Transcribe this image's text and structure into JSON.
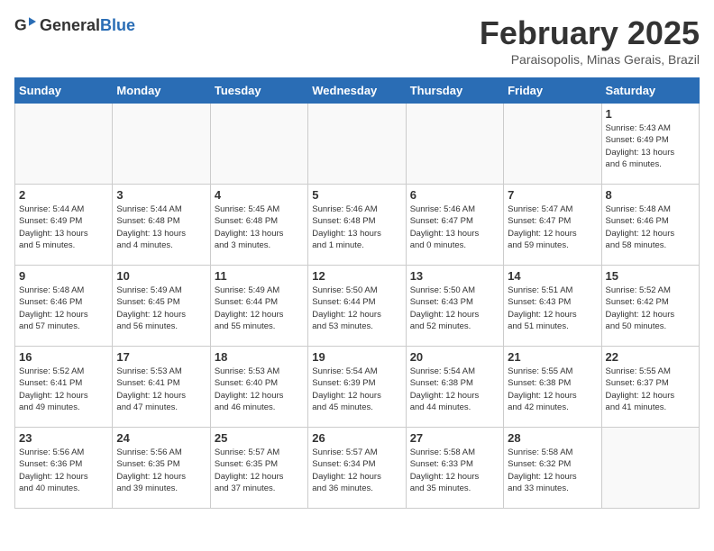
{
  "header": {
    "logo_general": "General",
    "logo_blue": "Blue",
    "title": "February 2025",
    "subtitle": "Paraisopolis, Minas Gerais, Brazil"
  },
  "days_of_week": [
    "Sunday",
    "Monday",
    "Tuesday",
    "Wednesday",
    "Thursday",
    "Friday",
    "Saturday"
  ],
  "weeks": [
    [
      {
        "day": "",
        "info": ""
      },
      {
        "day": "",
        "info": ""
      },
      {
        "day": "",
        "info": ""
      },
      {
        "day": "",
        "info": ""
      },
      {
        "day": "",
        "info": ""
      },
      {
        "day": "",
        "info": ""
      },
      {
        "day": "1",
        "info": "Sunrise: 5:43 AM\nSunset: 6:49 PM\nDaylight: 13 hours\nand 6 minutes."
      }
    ],
    [
      {
        "day": "2",
        "info": "Sunrise: 5:44 AM\nSunset: 6:49 PM\nDaylight: 13 hours\nand 5 minutes."
      },
      {
        "day": "3",
        "info": "Sunrise: 5:44 AM\nSunset: 6:48 PM\nDaylight: 13 hours\nand 4 minutes."
      },
      {
        "day": "4",
        "info": "Sunrise: 5:45 AM\nSunset: 6:48 PM\nDaylight: 13 hours\nand 3 minutes."
      },
      {
        "day": "5",
        "info": "Sunrise: 5:46 AM\nSunset: 6:48 PM\nDaylight: 13 hours\nand 1 minute."
      },
      {
        "day": "6",
        "info": "Sunrise: 5:46 AM\nSunset: 6:47 PM\nDaylight: 13 hours\nand 0 minutes."
      },
      {
        "day": "7",
        "info": "Sunrise: 5:47 AM\nSunset: 6:47 PM\nDaylight: 12 hours\nand 59 minutes."
      },
      {
        "day": "8",
        "info": "Sunrise: 5:48 AM\nSunset: 6:46 PM\nDaylight: 12 hours\nand 58 minutes."
      }
    ],
    [
      {
        "day": "9",
        "info": "Sunrise: 5:48 AM\nSunset: 6:46 PM\nDaylight: 12 hours\nand 57 minutes."
      },
      {
        "day": "10",
        "info": "Sunrise: 5:49 AM\nSunset: 6:45 PM\nDaylight: 12 hours\nand 56 minutes."
      },
      {
        "day": "11",
        "info": "Sunrise: 5:49 AM\nSunset: 6:44 PM\nDaylight: 12 hours\nand 55 minutes."
      },
      {
        "day": "12",
        "info": "Sunrise: 5:50 AM\nSunset: 6:44 PM\nDaylight: 12 hours\nand 53 minutes."
      },
      {
        "day": "13",
        "info": "Sunrise: 5:50 AM\nSunset: 6:43 PM\nDaylight: 12 hours\nand 52 minutes."
      },
      {
        "day": "14",
        "info": "Sunrise: 5:51 AM\nSunset: 6:43 PM\nDaylight: 12 hours\nand 51 minutes."
      },
      {
        "day": "15",
        "info": "Sunrise: 5:52 AM\nSunset: 6:42 PM\nDaylight: 12 hours\nand 50 minutes."
      }
    ],
    [
      {
        "day": "16",
        "info": "Sunrise: 5:52 AM\nSunset: 6:41 PM\nDaylight: 12 hours\nand 49 minutes."
      },
      {
        "day": "17",
        "info": "Sunrise: 5:53 AM\nSunset: 6:41 PM\nDaylight: 12 hours\nand 47 minutes."
      },
      {
        "day": "18",
        "info": "Sunrise: 5:53 AM\nSunset: 6:40 PM\nDaylight: 12 hours\nand 46 minutes."
      },
      {
        "day": "19",
        "info": "Sunrise: 5:54 AM\nSunset: 6:39 PM\nDaylight: 12 hours\nand 45 minutes."
      },
      {
        "day": "20",
        "info": "Sunrise: 5:54 AM\nSunset: 6:38 PM\nDaylight: 12 hours\nand 44 minutes."
      },
      {
        "day": "21",
        "info": "Sunrise: 5:55 AM\nSunset: 6:38 PM\nDaylight: 12 hours\nand 42 minutes."
      },
      {
        "day": "22",
        "info": "Sunrise: 5:55 AM\nSunset: 6:37 PM\nDaylight: 12 hours\nand 41 minutes."
      }
    ],
    [
      {
        "day": "23",
        "info": "Sunrise: 5:56 AM\nSunset: 6:36 PM\nDaylight: 12 hours\nand 40 minutes."
      },
      {
        "day": "24",
        "info": "Sunrise: 5:56 AM\nSunset: 6:35 PM\nDaylight: 12 hours\nand 39 minutes."
      },
      {
        "day": "25",
        "info": "Sunrise: 5:57 AM\nSunset: 6:35 PM\nDaylight: 12 hours\nand 37 minutes."
      },
      {
        "day": "26",
        "info": "Sunrise: 5:57 AM\nSunset: 6:34 PM\nDaylight: 12 hours\nand 36 minutes."
      },
      {
        "day": "27",
        "info": "Sunrise: 5:58 AM\nSunset: 6:33 PM\nDaylight: 12 hours\nand 35 minutes."
      },
      {
        "day": "28",
        "info": "Sunrise: 5:58 AM\nSunset: 6:32 PM\nDaylight: 12 hours\nand 33 minutes."
      },
      {
        "day": "",
        "info": ""
      }
    ]
  ]
}
